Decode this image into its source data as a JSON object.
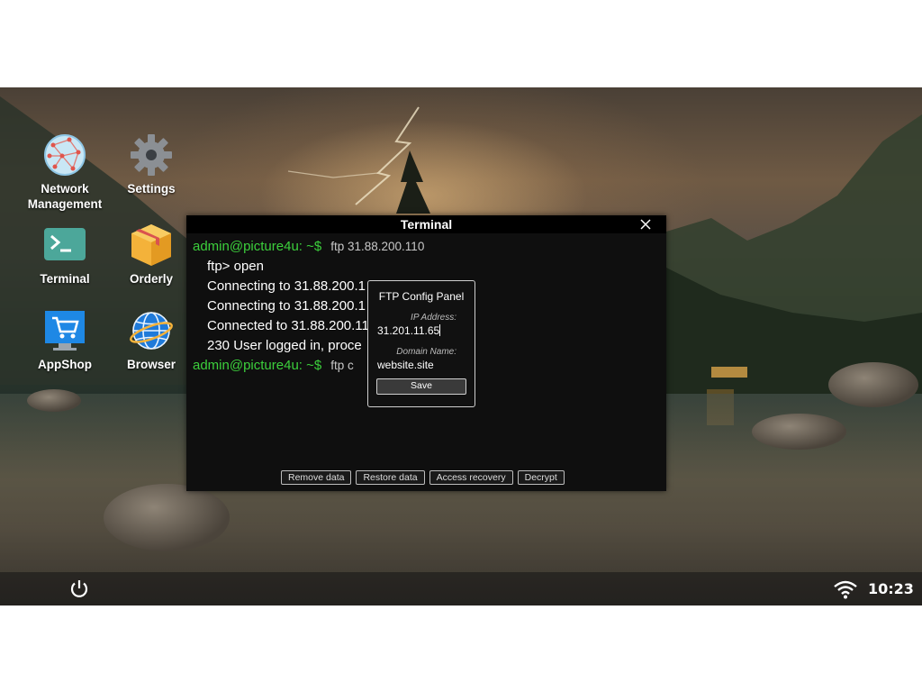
{
  "desktop": {
    "icons": [
      {
        "label": "Network\nManagement",
        "icon": "network-globe-icon"
      },
      {
        "label": "Settings",
        "icon": "gear-icon"
      },
      {
        "label": "Terminal",
        "icon": "terminal-icon"
      },
      {
        "label": "Orderly",
        "icon": "package-box-icon"
      },
      {
        "label": "AppShop",
        "icon": "shopping-cart-icon"
      },
      {
        "label": "Browser",
        "icon": "globe-browser-icon"
      }
    ]
  },
  "terminal": {
    "title": "Terminal",
    "lines": [
      {
        "prompt": "admin@picture4u: ~$",
        "cmd": "ftp 31.88.200.110"
      },
      {
        "text": "ftp> open"
      },
      {
        "text": "Connecting to 31.88.200.1"
      },
      {
        "text": "Connecting to 31.88.200.1"
      },
      {
        "text": "Connected to 31.88.200.11"
      },
      {
        "text": "230 User logged in, proce"
      },
      {
        "prompt": "admin@picture4u: ~$",
        "cmd": "ftp c"
      }
    ],
    "buttons": {
      "remove": "Remove data",
      "restore": "Restore data",
      "access": "Access recovery",
      "decrypt": "Decrypt"
    }
  },
  "ftp_panel": {
    "title": "FTP Config Panel",
    "ip_label": "IP Address:",
    "ip_value": "31.201.11.65",
    "domain_label": "Domain Name:",
    "domain_value": "website.site",
    "save_label": "Save"
  },
  "taskbar": {
    "time": "10:23",
    "icons": [
      "power-icon",
      "wifi-icon"
    ]
  },
  "colors": {
    "prompt": "#3ccf3c",
    "terminal_bg": "#0f0f0f"
  }
}
